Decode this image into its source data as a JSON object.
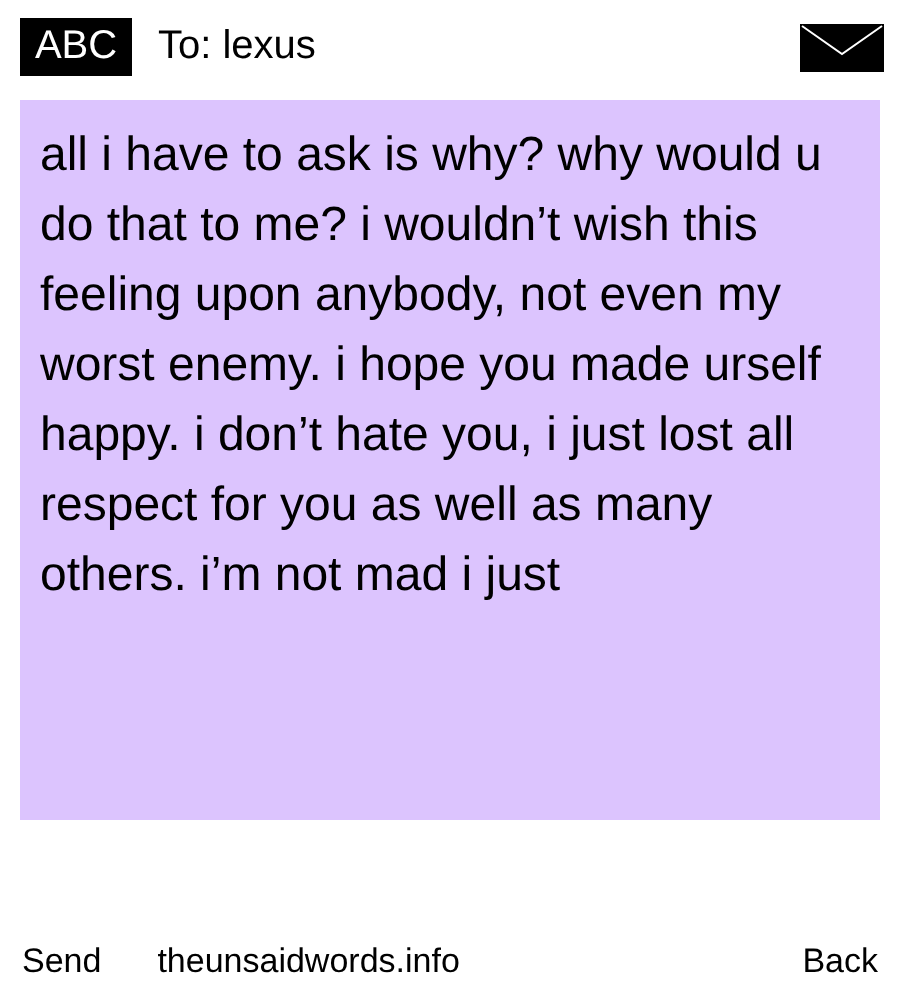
{
  "header": {
    "mode_badge": "ABC",
    "recipient": "To: lexus"
  },
  "message": {
    "text": "all i have to ask is why? why would u do that to me? i wouldn’t wish this feeling upon anybody, not even my worst enemy. i hope you made urself happy. i don’t hate you, i just lost all respect for you as well as many others. i’m not mad i just"
  },
  "softkeys": {
    "left": "Send",
    "center": "theunsaidwords.info",
    "right": "Back"
  }
}
